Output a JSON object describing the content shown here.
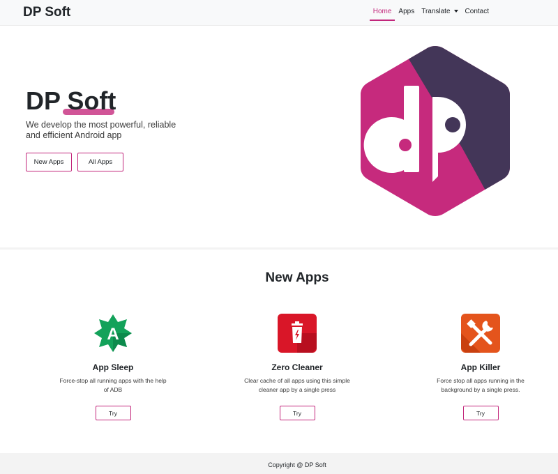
{
  "navbar": {
    "brand": "DP Soft",
    "items": [
      {
        "label": "Home",
        "active": true
      },
      {
        "label": "Apps",
        "active": false
      },
      {
        "label": "Translate",
        "active": false,
        "dropdown": true
      },
      {
        "label": "Contact",
        "active": false
      }
    ]
  },
  "hero": {
    "title_part1": "DP ",
    "title_part2": "Soft",
    "subtitle": "We develop the most powerful, reliable and efficient Android app",
    "buttons": {
      "new_apps": "New Apps",
      "all_apps": "All Apps"
    },
    "logo": {
      "icon": "dp-logo-icon",
      "colors": {
        "magenta": "#c62a7d",
        "dark": "#433658",
        "white": "#ffffff"
      }
    }
  },
  "new_apps": {
    "title": "New Apps",
    "apps": [
      {
        "name": "App Sleep",
        "desc": "Force-stop all running apps with the help of ADB",
        "button": "Try",
        "icon": "app-sleep-icon",
        "icon_letter": "A",
        "color": "#13a25a"
      },
      {
        "name": "Zero Cleaner",
        "desc": "Clear cache of all apps using this simple cleaner app by a single press",
        "button": "Try",
        "icon": "trash-icon",
        "color": "#d91628"
      },
      {
        "name": "App Killer",
        "desc": "Force stop all apps running in the background by a single press.",
        "button": "Try",
        "icon": "tools-icon",
        "color": "#e4541c"
      }
    ]
  },
  "footer": {
    "copyright": "Copyright @ DP Soft"
  },
  "colors": {
    "accent": "#c2267b",
    "navbar_bg": "#f8f9fa",
    "footer_bg": "#f3f3f3"
  }
}
